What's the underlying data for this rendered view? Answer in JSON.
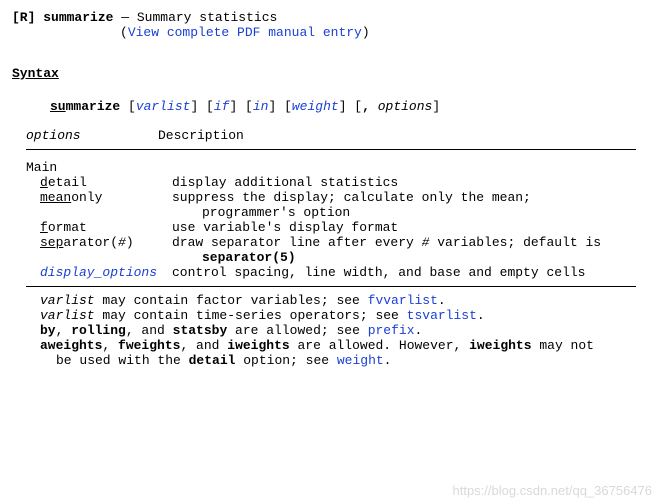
{
  "title": {
    "tag": "[R]",
    "command": "summarize",
    "dash": "—",
    "desc": "Summary statistics",
    "pdf_open": "(",
    "pdf_link": "View complete PDF manual entry",
    "pdf_close": ")"
  },
  "syntax": {
    "heading": "Syntax",
    "cmd_u": "su",
    "cmd_rest": "mmarize",
    "varlist": "varlist",
    "if": "if",
    "in": "in",
    "weight": "weight",
    "options": "options"
  },
  "table": {
    "header_options": "options",
    "header_desc": "Description",
    "main": "Main",
    "rows": [
      {
        "opt_u": "d",
        "opt_rest": "etail",
        "desc": "display additional statistics"
      },
      {
        "opt_u": "mean",
        "opt_rest": "only",
        "desc": "suppress the display; calculate only the mean;",
        "cont": "programmer's option"
      },
      {
        "opt_u": "f",
        "opt_rest": "ormat",
        "desc": "use variable's display format"
      },
      {
        "opt_u": "sep",
        "opt_rest": "arator(",
        "opt_arg": "#",
        "opt_close": ")",
        "desc": "draw separator line after every ",
        "desc_hash": "#",
        "desc2": " variables; default is",
        "desc_cont_bold": "separator(5)"
      },
      {
        "opt_link": "display_options",
        "desc": "control spacing, line width, and base and empty cells"
      }
    ]
  },
  "notes": {
    "n1_a": "varlist",
    "n1_b": " may contain factor variables; see ",
    "n1_link": "fvvarlist",
    "n1_c": ".",
    "n2_a": "varlist",
    "n2_b": " may contain time-series operators; see ",
    "n2_link": "tsvarlist",
    "n2_c": ".",
    "n3_a": "by",
    "n3_b": ", ",
    "n3_c": "rolling",
    "n3_d": ", and ",
    "n3_e": "statsby",
    "n3_f": " are allowed; see ",
    "n3_link": "prefix",
    "n3_g": ".",
    "n4_a": "aweights",
    "n4_b": ", ",
    "n4_c": "fweights",
    "n4_d": ", and ",
    "n4_e": "iweights",
    "n4_f": " are allowed.  However, ",
    "n4_g": "iweights",
    "n4_h": " may not",
    "n4_cont_a": "be used with the ",
    "n4_cont_b": "detail",
    "n4_cont_c": " option; see ",
    "n4_cont_link": "weight",
    "n4_cont_d": "."
  },
  "watermark": "https://blog.csdn.net/qq_36756476"
}
